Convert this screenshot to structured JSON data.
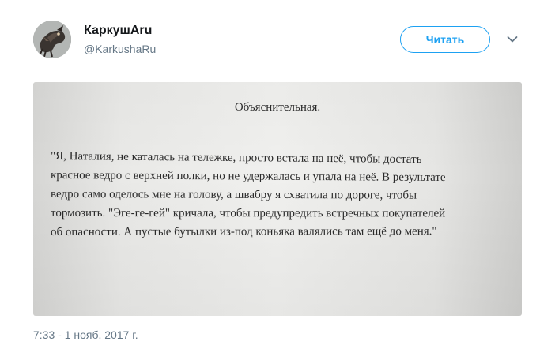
{
  "author": {
    "display_name": "КаркушAru",
    "handle": "@KarkushaRu"
  },
  "follow_button": {
    "label": "Читать"
  },
  "photo": {
    "title": "Объяснительная.",
    "lines": [
      "\"Я, Наталия, не каталась на тележке, просто встала на неё, чтобы достать",
      "красное ведро с верхней полки, но не удержалась и упала на неё. В результате",
      "ведро само оделось мне на голову, а швабру я схватила по дороге, чтобы",
      "тормозить. \"Эге-ге-гей\" кричала, чтобы предупредить встречных покупателей",
      "об опасности. А пустые бутылки из-под коньяка валялись там ещё до меня.\""
    ]
  },
  "timestamp": "7:33 - 1 нояб. 2017 г.",
  "colors": {
    "accent": "#1da1f2",
    "secondary_text": "#657786"
  }
}
